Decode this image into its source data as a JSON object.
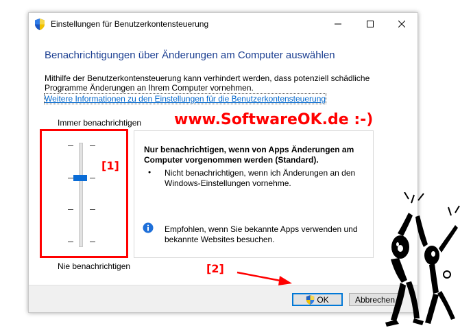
{
  "window": {
    "title": "Einstellungen für Benutzerkontensteuerung",
    "controls": [
      "minimize-icon",
      "maximize-icon",
      "close-icon"
    ]
  },
  "main": {
    "heading": "Benachrichtigungen über Änderungen am Computer auswählen",
    "description": "Mithilfe der Benutzerkontensteuerung kann verhindert werden, dass potenziell schädliche Programme Änderungen an Ihrem Computer vornehmen.",
    "more_info_link": "Weitere Informationen zu den Einstellungen für die Benutzerkontensteuerung"
  },
  "slider": {
    "top_label": "Immer benachrichtigen",
    "bottom_label": "Nie benachrichtigen",
    "levels": 4,
    "selected_level": 3,
    "level_counting": "from bottom"
  },
  "info": {
    "title": "Nur benachrichtigen, wenn von Apps Änderungen am Computer vorgenommen werden (Standard).",
    "bullet": "•",
    "bullet_text": "Nicht benachrichtigen, wenn ich Änderungen an den Windows-Einstellungen vornehme.",
    "recommendation": "Empfohlen, wenn Sie bekannte Apps verwenden und bekannte Websites besuchen."
  },
  "buttons": {
    "ok": "OK",
    "cancel": "Abbrechen"
  },
  "overlay": {
    "watermark": "www.SoftwareOK.de :-)",
    "marker1": "[1]",
    "marker2": "[2]",
    "accent": "#ff0000"
  },
  "colors": {
    "heading": "#1c3f91",
    "link": "#0066cc",
    "slider_thumb": "#0a6cd6"
  }
}
